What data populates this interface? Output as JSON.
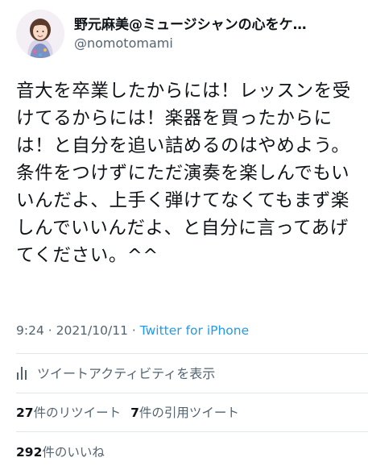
{
  "user": {
    "display_name": "野元麻美@ミュージシャンの心をケ…",
    "handle": "@nomotomami"
  },
  "tweet": {
    "text": "音大を卒業したからには！レッスンを受けてるからには！楽器を買ったからには！と自分を追い詰めるのはやめよう。条件をつけずにただ演奏を楽しんでもいいんだよ、上手く弾けてなくてもまず楽しんでいいんだよ、と自分に言ってあげてください。^^",
    "time": "9:24",
    "date": "2021/10/11",
    "separator": " · ",
    "source": "Twitter for iPhone"
  },
  "activity": {
    "label": "ツイートアクティビティを表示",
    "icon": "bar-chart-icon"
  },
  "stats": {
    "retweets_count": "27",
    "retweets_label": "件のリツイート",
    "quotes_count": "7",
    "quotes_label": "件の引用ツイート",
    "likes_count": "292",
    "likes_label": "件のいいね"
  },
  "colors": {
    "link": "#1d9bf0",
    "secondary": "#536471",
    "divider": "#e1e6ea"
  }
}
